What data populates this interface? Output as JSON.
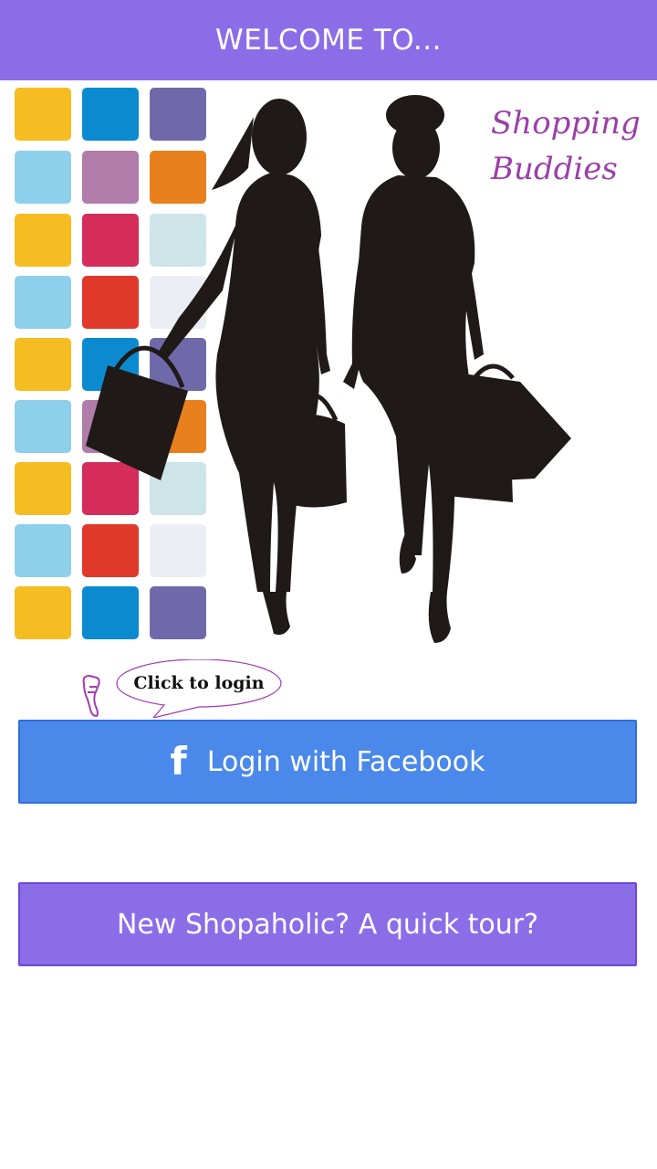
{
  "app_bar": {
    "title": "WELCOME TO..."
  },
  "hero": {
    "logo_line1": "Shopping",
    "logo_line2": "Buddies"
  },
  "tip": {
    "text": "Click to login"
  },
  "buttons": {
    "facebook_icon": "f",
    "facebook_label": "Login with Facebook",
    "tour_label": "New Shopaholic? A quick tour?"
  },
  "colors": {
    "app_bar": "#8b6de8",
    "facebook_button": "#4a89ea",
    "tour_button": "#8b6de8",
    "logo_text": "#9b3fa8"
  },
  "icons": {
    "pointer": "pointing-hand-icon",
    "facebook": "facebook-icon"
  }
}
